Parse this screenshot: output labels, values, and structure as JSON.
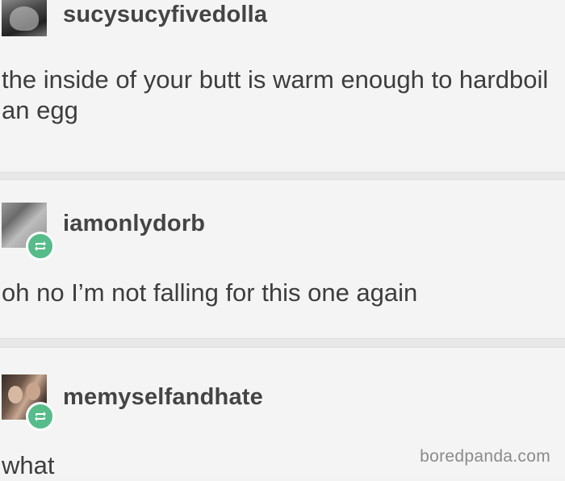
{
  "posts": [
    {
      "username": "sucysucyfivedolla",
      "text": "the inside of your butt is warm enough to hardboil an egg",
      "reblogged": false
    },
    {
      "username": "iamonlydorb",
      "text": "oh no I’m not falling for this one again",
      "reblogged": true
    },
    {
      "username": "memyselfandhate",
      "text": "what",
      "reblogged": true
    }
  ],
  "watermark": "boredpanda.com",
  "colors": {
    "reblog_badge": "#56bc8a",
    "background": "#f4f4f4",
    "text": "#3d3d3d"
  }
}
